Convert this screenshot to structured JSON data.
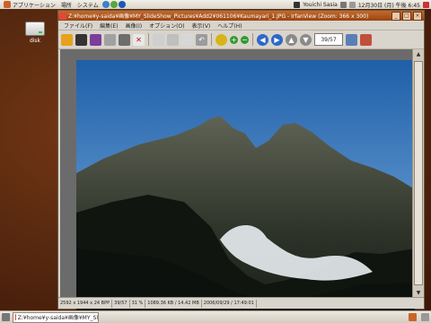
{
  "top_panel": {
    "menus": [
      "アプリケーション",
      "場所",
      "システム"
    ],
    "user": "Youichi Sasia",
    "datetime": "12月30日 (月) 午後 6:45"
  },
  "desktop": {
    "disk_label": "disk"
  },
  "window": {
    "title": "Z:¥home¥y-saida¥画像¥MY_SlideShow_Pictures¥Add2¥061106¥Kaumayari_1.JPG - IrfanView (Zoom: 366 x 300)",
    "menu": [
      "ファイル(F)",
      "編集(E)",
      "画像(I)",
      "オプション(O)",
      "表示(V)",
      "ヘルプ(H)"
    ],
    "counter": "39/57",
    "status": [
      "2592 x 1944 x 24 BPP",
      "39/57",
      "31 %",
      "1089.36 KB / 14.42 MB",
      "2006/09/29 / 17:49:01"
    ]
  },
  "taskbar": {
    "task_label": "Z:¥home¥y-saida¥画像¥MY_Sl"
  },
  "colors": {
    "titlebar": "#b25820",
    "sky_top": "#1f5fa8",
    "sky_bottom": "#7fb1e0"
  }
}
